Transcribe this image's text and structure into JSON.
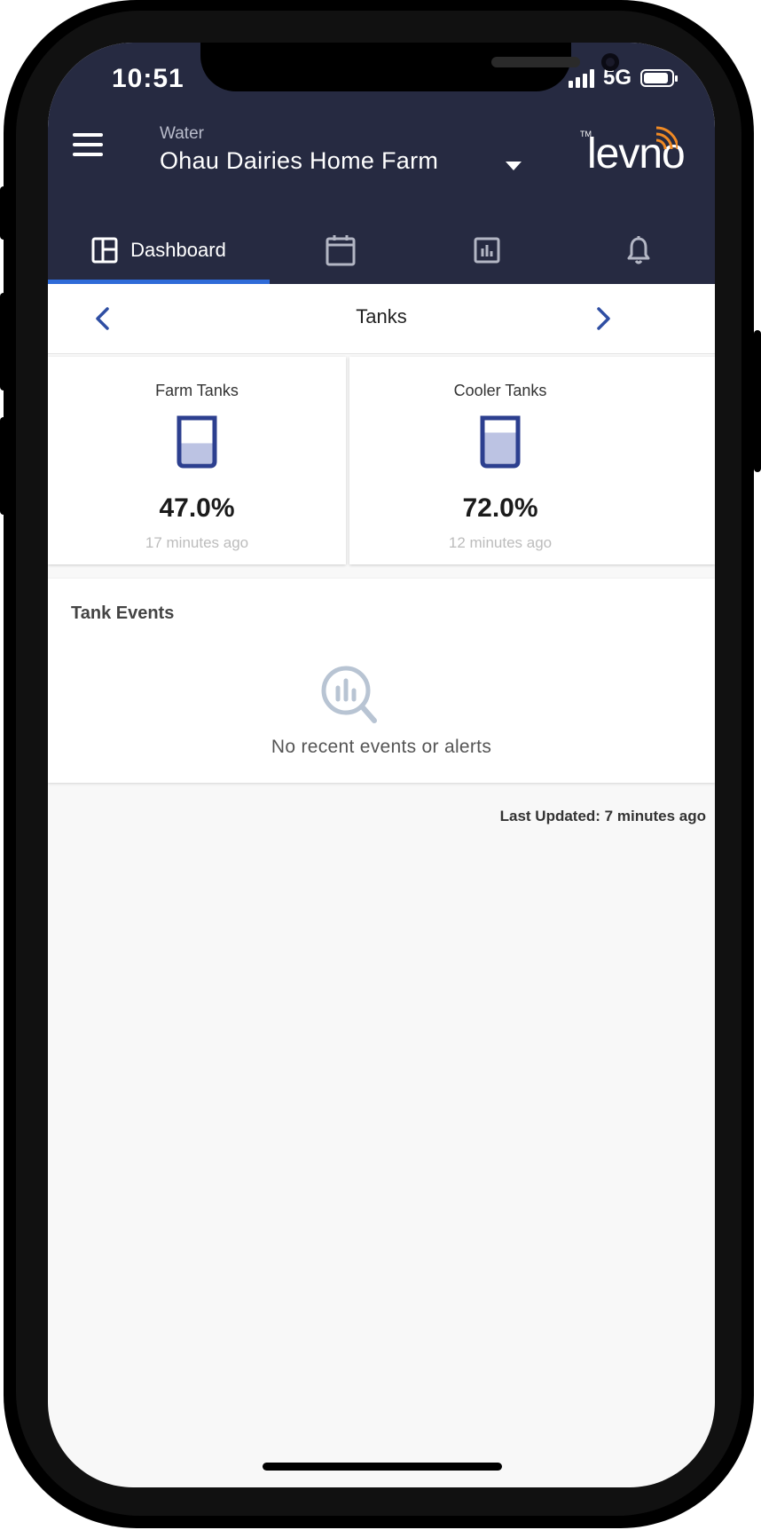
{
  "status_bar": {
    "time": "10:51",
    "network": "5G",
    "battery_level": 0.9
  },
  "header": {
    "farm_type": "Water",
    "farm_name": "Ohau Dairies Home Farm",
    "logo_text": "levno",
    "logo_tm": "TM"
  },
  "tabs": [
    {
      "label": "Dashboard",
      "icon": "dashboard-icon",
      "active": true
    },
    {
      "label": "",
      "icon": "calendar-icon",
      "active": false
    },
    {
      "label": "",
      "icon": "bar-chart-icon",
      "active": false
    },
    {
      "label": "",
      "icon": "bell-icon",
      "active": false
    }
  ],
  "tank_nav": {
    "title": "Tanks"
  },
  "tanks": [
    {
      "name": "Farm Tanks",
      "level_text": "47.0%",
      "level": 47.0,
      "updated": "17 minutes ago"
    },
    {
      "name": "Cooler Tanks",
      "level_text": "72.0%",
      "level": 72.0,
      "updated": "12 minutes ago"
    }
  ],
  "events": {
    "title": "Tank Events",
    "empty_message": "No recent events or alerts",
    "empty_icon": "search-chart-icon"
  },
  "footer": {
    "last_updated": "Last Updated: 7 minutes ago"
  },
  "colors": {
    "header_bg": "#262a41",
    "accent": "#2f6bd8",
    "tank_outline": "#2c3f8f",
    "tank_fill": "#bcc3e3"
  }
}
